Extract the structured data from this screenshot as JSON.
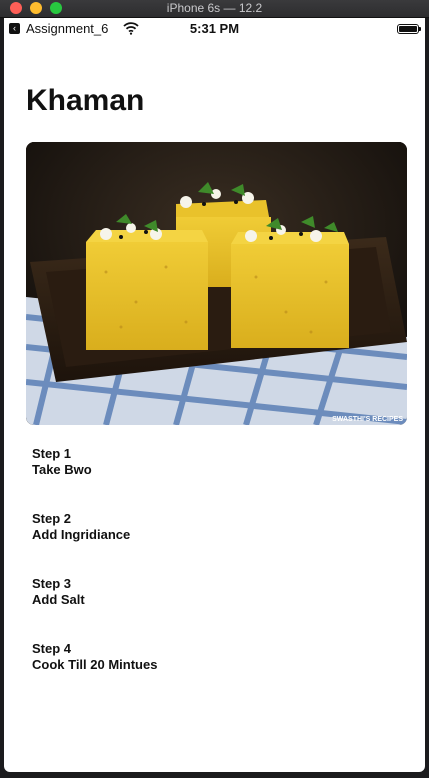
{
  "window": {
    "title": "iPhone 6s — 12.2"
  },
  "status_bar": {
    "back_app": "Assignment_6",
    "time": "5:31 PM"
  },
  "page": {
    "title": "Khaman",
    "image": {
      "alt": "Khaman dhokla",
      "watermark": "SWASTHI'S RECIPES"
    }
  },
  "steps": [
    {
      "title": "Step 1",
      "description": "Take Bwo"
    },
    {
      "title": "Step 2",
      "description": "Add Ingridiance"
    },
    {
      "title": "Step 3",
      "description": "Add Salt"
    },
    {
      "title": "Step 4",
      "description": "Cook Till 20 Mintues"
    }
  ],
  "icons": {
    "back": "back-icon",
    "wifi": "wifi-icon",
    "battery": "battery-icon"
  },
  "colors": {
    "background": "#ffffff",
    "text": "#111111",
    "khaman": "#e7c22a"
  }
}
